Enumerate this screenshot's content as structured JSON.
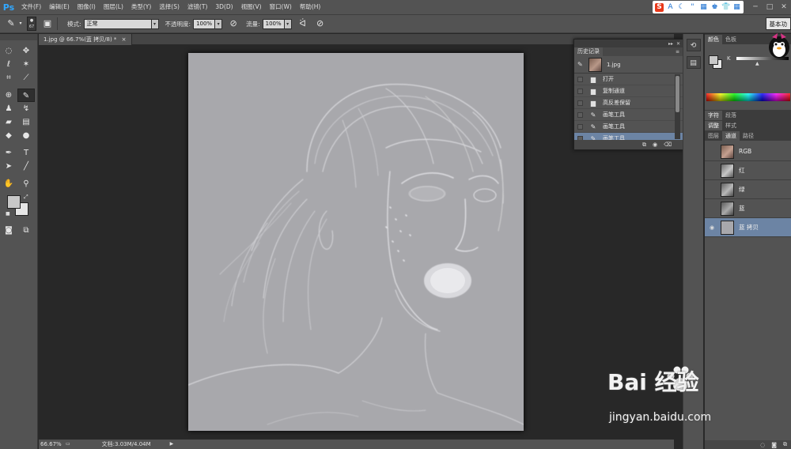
{
  "app": {
    "logo": "Ps",
    "menu": [
      "文件(F)",
      "编辑(E)",
      "图像(I)",
      "图层(L)",
      "类型(Y)",
      "选择(S)",
      "滤镜(T)",
      "3D(D)",
      "视图(V)",
      "窗口(W)",
      "帮助(H)"
    ],
    "window_controls": [
      "─",
      "□",
      "✕"
    ],
    "workspace": "基本功"
  },
  "tray_icons": [
    "S",
    "A",
    "☾",
    "\"",
    "▦",
    "♚",
    "👕",
    "▦"
  ],
  "options_bar": {
    "brush_size": "67",
    "mode_label": "模式:",
    "mode_value": "正常",
    "opacity_label": "不透明度:",
    "opacity_value": "100%",
    "flow_label": "流量:",
    "flow_value": "100%"
  },
  "document": {
    "tab_title": "1.jpg @ 66.7%(蓝 拷贝/8) *",
    "tab_close": "×",
    "zoom": "66.67%",
    "doc_size": "文档:3.03M/4.04M",
    "status_arrow": "▶"
  },
  "history_panel": {
    "title": "历史记录",
    "snapshot_label": "1.jpg",
    "items": [
      {
        "label": "打开",
        "icon": "document-icon"
      },
      {
        "label": "复制通道",
        "icon": "document-icon"
      },
      {
        "label": "高反差保留",
        "icon": "document-icon"
      },
      {
        "label": "画笔工具",
        "icon": "brush-icon"
      },
      {
        "label": "画笔工具",
        "icon": "brush-icon"
      },
      {
        "label": "画笔工具",
        "icon": "brush-icon",
        "selected": true
      }
    ]
  },
  "color_panel": {
    "tabs": [
      "颜色",
      "色板"
    ],
    "channel_letter": "K"
  },
  "mid_tabs_1": [
    "字符",
    "段落"
  ],
  "mid_tabs_2": [
    "调整",
    "样式"
  ],
  "channels_panel": {
    "tabs": [
      "图层",
      "通道",
      "路径"
    ],
    "rows": [
      {
        "label": "RGB",
        "visible": false
      },
      {
        "label": "红",
        "visible": false
      },
      {
        "label": "绿",
        "visible": false
      },
      {
        "label": "蓝",
        "visible": false
      },
      {
        "label": "蓝 拷贝",
        "visible": true,
        "selected": true
      }
    ]
  },
  "watermark": {
    "brand": "Bai  经验",
    "url": "jingyan.baidu.com"
  },
  "colors": {
    "selection_blue": "#6c84a4",
    "panel_gray": "#535353",
    "canvas_bg": "#282828",
    "image_gray": "#a8a8ac"
  }
}
